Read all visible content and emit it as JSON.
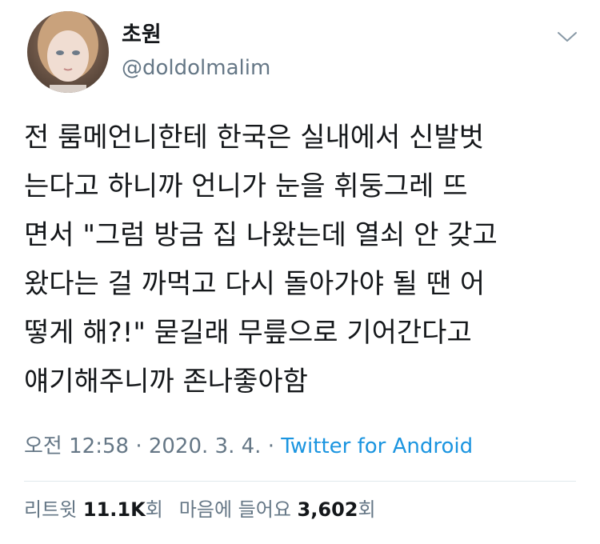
{
  "user": {
    "display_name": "초원",
    "handle": "@doldolmalim",
    "avatar_icon": "profile-photo"
  },
  "menu_icon": "chevron-down-icon",
  "tweet": {
    "lines": [
      "전 룸메언니한테 한국은 실내에서 신발벗",
      "는다고 하니까 언니가 눈을 휘둥그레 뜨",
      "면서 \"그럼 방금 집 나왔는데 열쇠 안 갖고",
      "왔다는 걸 까먹고 다시 돌아가야 될 땐 어",
      "떻게 해?!\" 묻길래 무릎으로 기어간다고",
      "얘기해주니까 존나좋아함"
    ]
  },
  "meta": {
    "time": "오전 12:58",
    "separator": "·",
    "date": "2020. 3. 4.",
    "source": "Twitter for Android"
  },
  "stats": {
    "retweet_label": "리트윗",
    "retweet_count": "11.1K",
    "retweet_unit": "회",
    "like_label": "마음에 들어요",
    "like_count": "3,602",
    "like_unit": "회"
  },
  "colors": {
    "text": "#14171a",
    "secondary": "#657786",
    "link": "#1b95e0",
    "divider": "#e1e8ed"
  }
}
